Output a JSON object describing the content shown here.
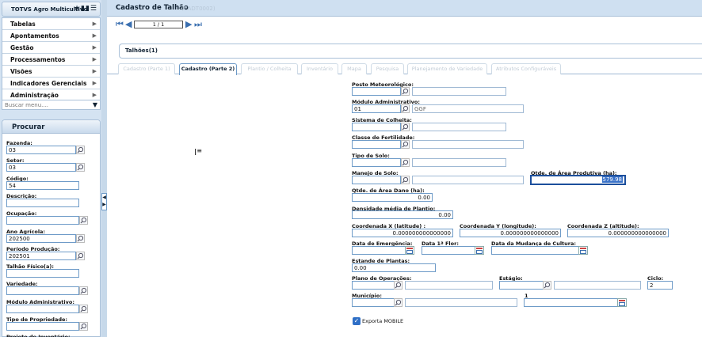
{
  "app": {
    "title": "TOTVS Agro Multicultivo",
    "icons": [
      "star-icon",
      "bar-chart-icon",
      "list-icon"
    ]
  },
  "menu": {
    "items": [
      "Tabelas",
      "Apontamentos",
      "Gestão",
      "Processamentos",
      "Visões",
      "Indicadores Gerenciais",
      "Administração"
    ],
    "search_placeholder": "Buscar menu...."
  },
  "procurar": {
    "title": "Procurar",
    "fields": [
      {
        "label": "Fazenda:",
        "value": "03"
      },
      {
        "label": "Setor:",
        "value": "03"
      },
      {
        "label": "Código:",
        "value": "54"
      },
      {
        "label": "Descrição:",
        "value": ""
      },
      {
        "label": "Ocupação:",
        "value": ""
      },
      {
        "label": "Ano Agrícola:",
        "value": "202500"
      },
      {
        "label": "Período Produção:",
        "value": "202501"
      },
      {
        "label": "Talhão Físico(a):",
        "value": ""
      },
      {
        "label": "Variedade:",
        "value": ""
      },
      {
        "label": "Módulo Administrativo:",
        "value": ""
      },
      {
        "label": "Tipo de Propriedade:",
        "value": ""
      },
      {
        "label": "Projeto de Inventário:",
        "value": ""
      }
    ]
  },
  "page": {
    "title": "Cadastro de Talhão",
    "subtitle": "(CADT0002)",
    "pager": "1 / 1",
    "group_label": "Talhões(1)"
  },
  "tabs": [
    "Cadastro (Parte 1)",
    "Cadastro (Parte 2)",
    "Plantio / Colheita",
    "Inventário",
    "Mapa",
    "Pesquisa",
    "Planejamento de Variedade",
    "Atributos Configuráveis"
  ],
  "form": {
    "posto_label": "Posto Meteorológico:",
    "posto_code": "",
    "posto_desc": "",
    "modulo_label": "Módulo Administrativo:",
    "modulo_code": "01",
    "modulo_desc": "GGF",
    "sistema_label": "Sistema de Colheita:",
    "sistema_code": "",
    "sistema_desc": "",
    "classe_label": "Classe de Fertilidade:",
    "classe_code": "",
    "classe_desc": "",
    "tipo_solo_label": "Tipo de Solo:",
    "tipo_solo_code": "",
    "tipo_solo_desc": "",
    "manejo_label": "Manejo de Solo:",
    "manejo_code": "",
    "manejo_desc": "",
    "area_prod_label": "Qtde. de Área Produtiva (ha):",
    "area_prod_value": "579.98",
    "area_dano_label": "Qtde. de Área Dano (ha):",
    "area_dano_value": "0.00",
    "densidade_label": "Densidade média de Plantio:",
    "densidade_value": "0.00",
    "coord_x_label": "Coordenada X (latitude) :",
    "coord_x_value": "0.000000000000000",
    "coord_y_label": "Coordenada Y (longitude):",
    "coord_y_value": "0.000000000000000",
    "coord_z_label": "Coordenada Z (altitude):",
    "coord_z_value": "0.000000000000000",
    "emergencia_label": "Data de Emergência:",
    "emergencia_value": "",
    "flor_label": "Data 1ª Flor:",
    "flor_value": "",
    "mudanca_label": "Data da Mudança de Cultura:",
    "mudanca_value": "",
    "estande_label": "Estande de Plantas:",
    "estande_value": "0.00",
    "plano_label": "Plano de Operações:",
    "plano_code": "",
    "plano_desc": "",
    "estagio_label": "Estágio:",
    "estagio_code": "",
    "estagio_desc": "",
    "ciclo_label": "Ciclo:",
    "ciclo_value": "2",
    "municipio_label": "Município:",
    "municipio_code": "",
    "municipio_desc": "",
    "unlabeled_date_label": "1",
    "unlabeled_date_value": "",
    "exporta_label": "Exporta MOBILE",
    "exporta_checked": true
  }
}
